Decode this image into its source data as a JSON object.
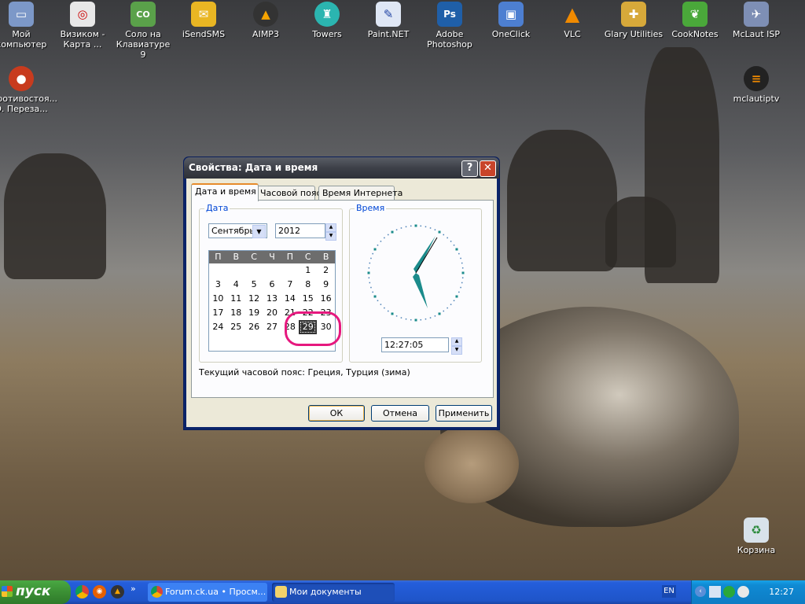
{
  "desktop": {
    "icons": [
      {
        "label": "Мой\nкомпьютер",
        "icon": "computer-icon"
      },
      {
        "label": "Визиком -\nКарта ...",
        "icon": "map-icon"
      },
      {
        "label": "Соло на\nКлавиатуре 9",
        "icon": "keyboard-icon"
      },
      {
        "label": "iSendSMS",
        "icon": "sms-icon"
      },
      {
        "label": "AIMP3",
        "icon": "aimp-icon"
      },
      {
        "label": "Towers",
        "icon": "towers-icon"
      },
      {
        "label": "Paint.NET",
        "icon": "paint-icon"
      },
      {
        "label": "Adobe\nPhotoshop",
        "icon": "photoshop-icon"
      },
      {
        "label": "OneClick",
        "icon": "oneclick-icon"
      },
      {
        "label": "VLC",
        "icon": "vlc-icon"
      },
      {
        "label": "Glary Utilities",
        "icon": "glary-icon"
      },
      {
        "label": "CookNotes",
        "icon": "cooknotes-icon"
      },
      {
        "label": "McLaut ISP",
        "icon": "mclaut-icon"
      },
      {
        "label": "Противостоя...\nО. Переза...",
        "icon": "game-icon"
      },
      {
        "label": "mclautiptv",
        "icon": "iptv-icon"
      },
      {
        "label": "Корзина",
        "icon": "recycle-bin-icon"
      }
    ]
  },
  "dialog": {
    "title": "Свойства: Дата и время",
    "help_glyph": "?",
    "close_glyph": "✕",
    "tabs": [
      "Дата и время",
      "Часовой пояс",
      "Время Интернета"
    ],
    "date_group": "Дата",
    "time_group": "Время",
    "month": "Сентябрь",
    "year": "2012",
    "weekdays": [
      "П",
      "В",
      "С",
      "Ч",
      "П",
      "С",
      "В"
    ],
    "calendar": [
      [
        "",
        "",
        "",
        "",
        "",
        "1",
        "2"
      ],
      [
        "3",
        "4",
        "5",
        "6",
        "7",
        "8",
        "9"
      ],
      [
        "10",
        "11",
        "12",
        "13",
        "14",
        "15",
        "16"
      ],
      [
        "17",
        "18",
        "19",
        "20",
        "21",
        "22",
        "23"
      ],
      [
        "24",
        "25",
        "26",
        "27",
        "28",
        "29",
        "30"
      ]
    ],
    "selected_day": "29",
    "time": "12:27:05",
    "timezone_text": "Текущий часовой пояс: Греция, Турция (зима)",
    "ok": "ОК",
    "cancel": "Отмена",
    "apply": "Применить"
  },
  "taskbar": {
    "start": "пуск",
    "tasks": [
      {
        "label": "Forum.ck.ua • Просм...",
        "icon": "chrome-icon"
      },
      {
        "label": "Мои документы",
        "icon": "folder-icon"
      }
    ],
    "lang": "EN",
    "clock": "12:27"
  },
  "colors": {
    "highlight": "#e6187e",
    "clock_hands": "#1b8b8b",
    "taskbar": "#245edb",
    "start": "#3b8f34"
  }
}
